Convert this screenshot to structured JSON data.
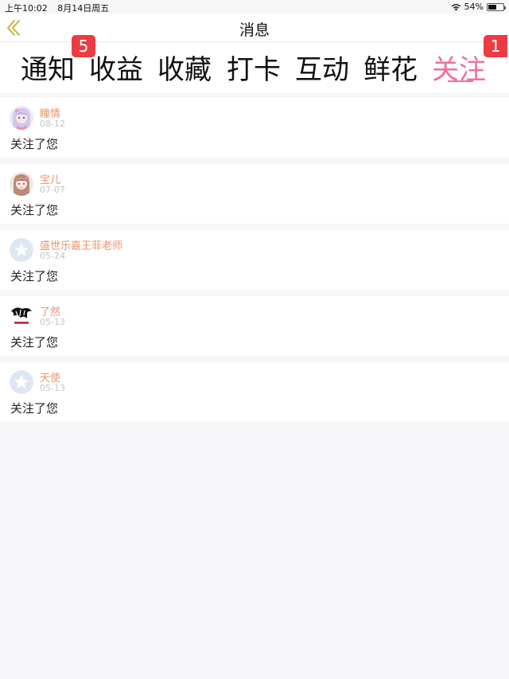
{
  "status_bar": {
    "time": "上午10:02",
    "date": "8月14日周五",
    "battery": "54%",
    "battery_level": 0.54
  },
  "header": {
    "title": "消息"
  },
  "tabs": [
    {
      "label": "通知",
      "badge": "5"
    },
    {
      "label": "收益"
    },
    {
      "label": "收藏"
    },
    {
      "label": "打卡"
    },
    {
      "label": "互动"
    },
    {
      "label": "鲜花"
    },
    {
      "label": "关注",
      "badge": "1",
      "active": true
    }
  ],
  "items": [
    {
      "name": "瞳情",
      "date": "08-12",
      "text": "关注了您",
      "avatar": "anime-girl-avatar"
    },
    {
      "name": "宝儿",
      "date": "07-07",
      "text": "关注了您",
      "avatar": "girl-avatar"
    },
    {
      "name": "盛世乐嘉王菲老师",
      "date": "05-24",
      "text": "关注了您",
      "avatar": "default-star-avatar"
    },
    {
      "name": "了然",
      "date": "05-13",
      "text": "关注了您",
      "avatar": "ink-logo-avatar"
    },
    {
      "name": "天使",
      "date": "05-13",
      "text": "关注了您",
      "avatar": "default-star-avatar"
    }
  ],
  "colors": {
    "accent": "#ef6f9f",
    "badge": "#ec3b43",
    "username": "#e8956b",
    "background": "#f7f6f8"
  }
}
